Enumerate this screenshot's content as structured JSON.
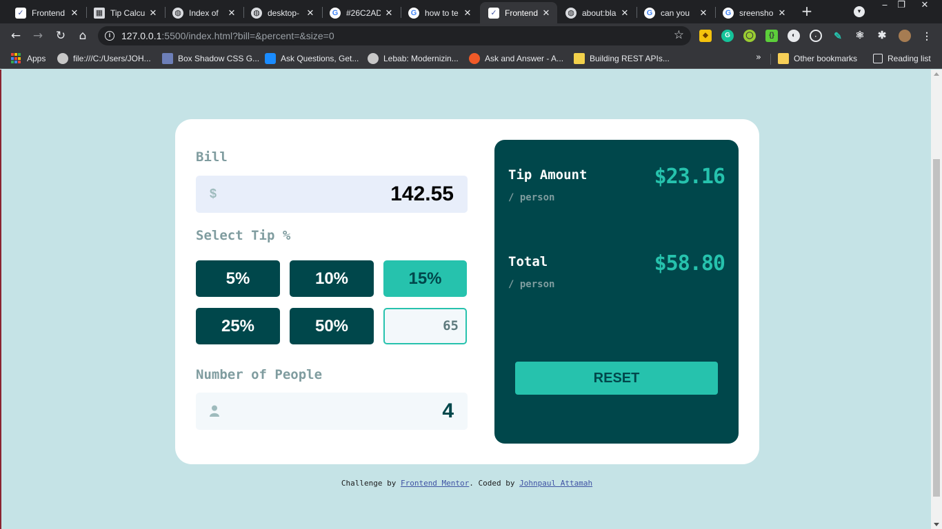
{
  "browser": {
    "tabs": [
      {
        "title": "Frontend",
        "icon": "frontend-mentor-icon"
      },
      {
        "title": "Tip Calcu",
        "icon": "calculator-icon"
      },
      {
        "title": "Index of",
        "icon": "globe-icon"
      },
      {
        "title": "desktop-",
        "icon": "globe-icon"
      },
      {
        "title": "#26C2AD",
        "icon": "google-icon"
      },
      {
        "title": "how to te",
        "icon": "google-icon"
      },
      {
        "title": "Frontend",
        "icon": "frontend-mentor-icon",
        "active": true
      },
      {
        "title": "about:bla",
        "icon": "globe-icon"
      },
      {
        "title": "can you",
        "icon": "google-icon"
      },
      {
        "title": "sreensho",
        "icon": "google-icon"
      }
    ],
    "url_host": "127.0.0.1",
    "url_rest": ":5500/index.html?bill=&percent=&size=0",
    "bookmarks": [
      {
        "label": "Apps"
      },
      {
        "label": "file:///C:/Users/JOH..."
      },
      {
        "label": "Box Shadow CSS G..."
      },
      {
        "label": "Ask Questions, Get..."
      },
      {
        "label": "Lebab: Modernizin..."
      },
      {
        "label": "Ask and Answer - A..."
      },
      {
        "label": "Building REST APIs..."
      },
      {
        "label": "Other bookmarks"
      },
      {
        "label": "Reading list"
      }
    ]
  },
  "calculator": {
    "bill_label": "Bill",
    "bill_icon": "$",
    "bill_value": "142.55",
    "tip_label": "Select Tip %",
    "tip_options": [
      "5%",
      "10%",
      "15%",
      "25%",
      "50%"
    ],
    "selected_tip": "15%",
    "custom_tip_value": "65",
    "people_label": "Number of People",
    "people_value": "4"
  },
  "result": {
    "tip_amount_label": "Tip Amount",
    "tip_amount_sub": "/ person",
    "tip_amount_value": "$23.16",
    "total_label": "Total",
    "total_sub": "/ person",
    "total_value": "$58.80",
    "reset_label": "RESET"
  },
  "footer": {
    "prefix": "Challenge by ",
    "link1": "Frontend Mentor",
    "middle": ". Coded by ",
    "link2": "Johnpaul Attamah"
  },
  "colors": {
    "strong_cyan": "#26c2ad",
    "very_dark_cyan": "#00474b",
    "page_bg": "#c5e3e6"
  }
}
